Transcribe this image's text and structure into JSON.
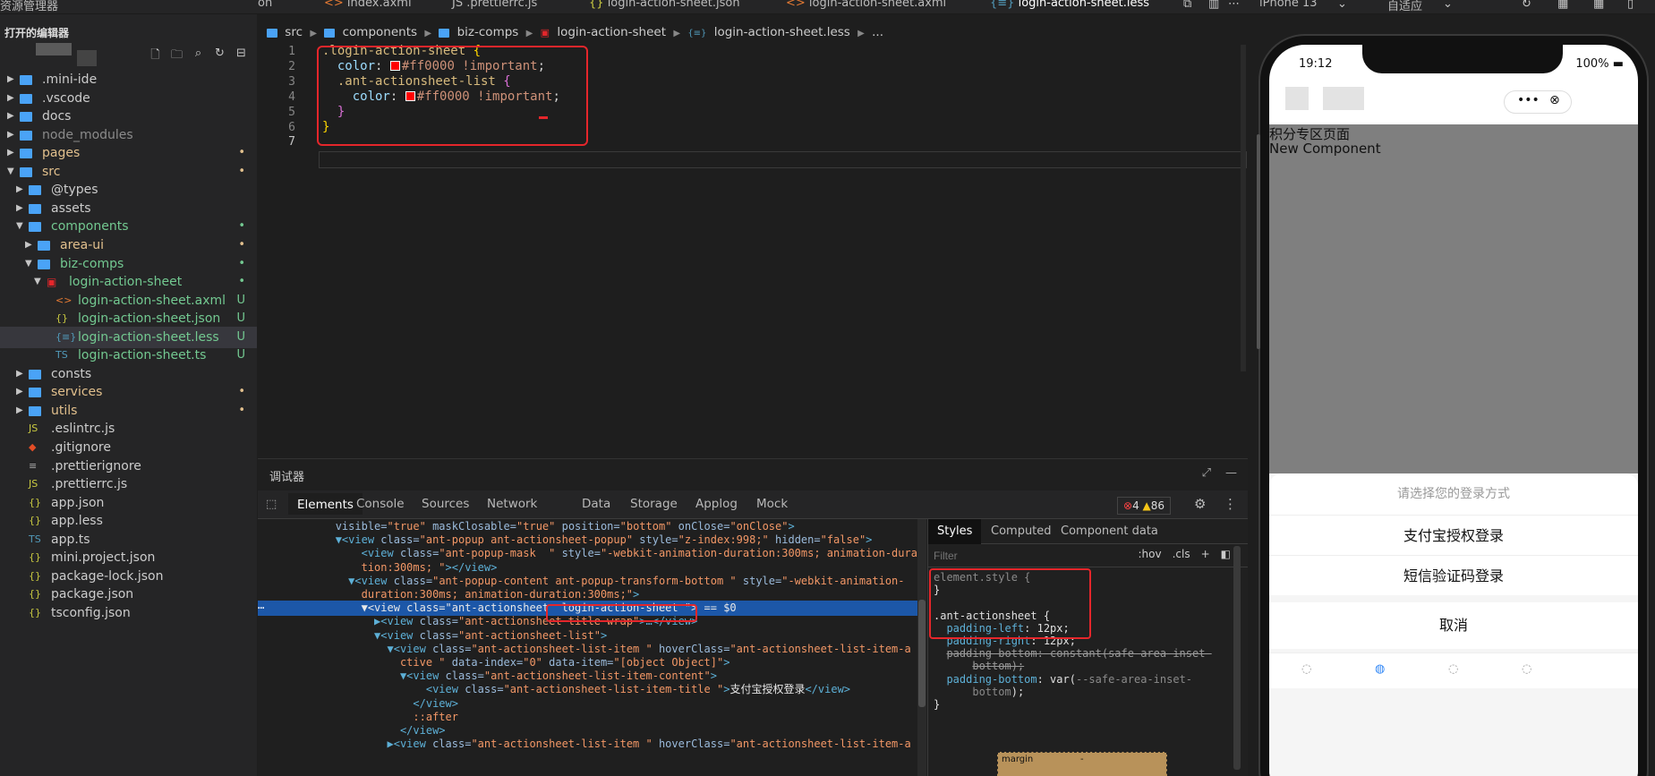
{
  "topbar": {
    "explorer_title": "资源管理器",
    "tabs": [
      {
        "icon": "json-file-icon",
        "label": "on"
      },
      {
        "icon": "axml-file-icon",
        "label": "index.axml"
      },
      {
        "icon": "js-file-icon",
        "label": "JS .prettierrc.js"
      },
      {
        "icon": "json-file-icon",
        "label": "login-action-sheet.json"
      },
      {
        "icon": "axml-file-icon",
        "label": "login-action-sheet.axml"
      },
      {
        "icon": "less-file-icon",
        "label": "login-action-sheet.less",
        "active": true
      }
    ],
    "device": "iPhone 13",
    "zoom": "自适应"
  },
  "sidebar": {
    "open_editors": "打开的编辑器",
    "tree": [
      {
        "name": ".mini-ide",
        "type": "folder",
        "depth": 0,
        "open": false,
        "status": ""
      },
      {
        "name": ".vscode",
        "type": "folder",
        "depth": 0,
        "open": false,
        "status": ""
      },
      {
        "name": "docs",
        "type": "folder",
        "depth": 0,
        "open": false,
        "status": ""
      },
      {
        "name": "node_modules",
        "type": "folder",
        "depth": 0,
        "open": false,
        "status": "",
        "dim": true
      },
      {
        "name": "pages",
        "type": "folder",
        "depth": 0,
        "open": false,
        "status": "•",
        "color": "#e2c08d"
      },
      {
        "name": "src",
        "type": "folder",
        "depth": 0,
        "open": true,
        "status": "•",
        "color": "#e2c08d"
      },
      {
        "name": "@types",
        "type": "folder",
        "depth": 1,
        "open": false,
        "status": ""
      },
      {
        "name": "assets",
        "type": "folder",
        "depth": 1,
        "open": false,
        "status": ""
      },
      {
        "name": "components",
        "type": "folder",
        "depth": 1,
        "open": true,
        "status": "•",
        "color": "#73c991"
      },
      {
        "name": "area-ui",
        "type": "folder",
        "depth": 2,
        "open": false,
        "status": "•",
        "color": "#e2c08d"
      },
      {
        "name": "biz-comps",
        "type": "folder",
        "depth": 2,
        "open": true,
        "status": "•",
        "color": "#73c991"
      },
      {
        "name": "login-action-sheet",
        "type": "folder-special",
        "depth": 3,
        "open": true,
        "status": "•",
        "color": "#73c991"
      },
      {
        "name": "login-action-sheet.axml",
        "type": "file",
        "icon": "<>",
        "iconColor": "#e37933",
        "depth": 4,
        "status": "U",
        "color": "#73c991"
      },
      {
        "name": "login-action-sheet.json",
        "type": "file",
        "icon": "{}",
        "iconColor": "#cbcb41",
        "depth": 4,
        "status": "U",
        "color": "#73c991"
      },
      {
        "name": "login-action-sheet.less",
        "type": "file",
        "icon": "{≡}",
        "iconColor": "#519aba",
        "depth": 4,
        "status": "U",
        "color": "#73c991",
        "selected": true
      },
      {
        "name": "login-action-sheet.ts",
        "type": "file",
        "icon": "TS",
        "iconColor": "#519aba",
        "depth": 4,
        "status": "U",
        "color": "#73c991"
      },
      {
        "name": "consts",
        "type": "folder",
        "depth": 1,
        "open": false,
        "status": ""
      },
      {
        "name": "services",
        "type": "folder",
        "depth": 1,
        "open": false,
        "status": "•",
        "color": "#e2c08d"
      },
      {
        "name": "utils",
        "type": "folder",
        "depth": 1,
        "open": false,
        "status": "•",
        "color": "#e2c08d"
      },
      {
        "name": ".eslintrc.js",
        "type": "file",
        "icon": "JS",
        "iconColor": "#cbcb41",
        "depth": 1,
        "status": ""
      },
      {
        "name": ".gitignore",
        "type": "file",
        "icon": "◆",
        "iconColor": "#e44d26",
        "depth": 1,
        "status": ""
      },
      {
        "name": ".prettierignore",
        "type": "file",
        "icon": "≡",
        "iconColor": "#aaaaaa",
        "depth": 1,
        "status": ""
      },
      {
        "name": ".prettierrc.js",
        "type": "file",
        "icon": "JS",
        "iconColor": "#cbcb41",
        "depth": 1,
        "status": ""
      },
      {
        "name": "app.json",
        "type": "file",
        "icon": "{}",
        "iconColor": "#cbcb41",
        "depth": 1,
        "status": ""
      },
      {
        "name": "app.less",
        "type": "file",
        "icon": "{}",
        "iconColor": "#cbcb41",
        "depth": 1,
        "status": ""
      },
      {
        "name": "app.ts",
        "type": "file",
        "icon": "TS",
        "iconColor": "#519aba",
        "depth": 1,
        "status": ""
      },
      {
        "name": "mini.project.json",
        "type": "file",
        "icon": "{}",
        "iconColor": "#cbcb41",
        "depth": 1,
        "status": ""
      },
      {
        "name": "package-lock.json",
        "type": "file",
        "icon": "{}",
        "iconColor": "#cbcb41",
        "depth": 1,
        "status": ""
      },
      {
        "name": "package.json",
        "type": "file",
        "icon": "{}",
        "iconColor": "#cbcb41",
        "depth": 1,
        "status": ""
      },
      {
        "name": "tsconfig.json",
        "type": "file",
        "icon": "{}",
        "iconColor": "#cbcb41",
        "depth": 1,
        "status": ""
      }
    ]
  },
  "editor": {
    "breadcrumb": [
      "src",
      "components",
      "biz-comps",
      "login-action-sheet",
      "login-action-sheet.less",
      "..."
    ],
    "line_numbers": [
      "1",
      "2",
      "3",
      "4",
      "5",
      "6",
      "7"
    ],
    "lines": [
      [
        {
          "c": "c-sel",
          "t": ".login-action-sheet "
        },
        {
          "c": "c-brace",
          "t": "{"
        }
      ],
      [
        {
          "c": "c-p",
          "t": "  "
        },
        {
          "c": "c-prop",
          "t": "color"
        },
        {
          "c": "c-p",
          "t": ": "
        },
        {
          "c": "sw",
          "t": ""
        },
        {
          "c": "c-val",
          "t": "#ff0000 !important"
        },
        {
          "c": "c-p",
          "t": ";"
        }
      ],
      [
        {
          "c": "c-p",
          "t": "  "
        },
        {
          "c": "c-sel",
          "t": ".ant-actionsheet-list "
        },
        {
          "c": "c-brace2",
          "t": "{"
        }
      ],
      [
        {
          "c": "c-p",
          "t": "    "
        },
        {
          "c": "c-prop",
          "t": "color"
        },
        {
          "c": "c-p",
          "t": ": "
        },
        {
          "c": "sw",
          "t": ""
        },
        {
          "c": "c-val",
          "t": "#ff0000 !important"
        },
        {
          "c": "c-p",
          "t": ";"
        }
      ],
      [
        {
          "c": "c-p",
          "t": "  "
        },
        {
          "c": "c-brace2",
          "t": "}"
        }
      ],
      [
        {
          "c": "c-brace",
          "t": "}"
        }
      ],
      [
        {
          "c": "c-p",
          "t": ""
        }
      ]
    ]
  },
  "debugger": {
    "title": "调试器",
    "tabs": [
      "Elements",
      "Console",
      "Sources",
      "Network",
      "Data",
      "Storage",
      "Applog",
      "Mock"
    ],
    "errors": "4",
    "warnings": "86",
    "elements": [
      {
        "indent": 6,
        "html": [
          {
            "c": "t-attr",
            "t": "visible="
          },
          {
            "c": "t-val",
            "t": "\"true\""
          },
          {
            "c": "t-attr",
            "t": " maskClosable="
          },
          {
            "c": "t-val",
            "t": "\"true\""
          },
          {
            "c": "t-attr",
            "t": " position="
          },
          {
            "c": "t-val",
            "t": "\"bottom\""
          },
          {
            "c": "t-attr",
            "t": " onClose="
          },
          {
            "c": "t-val",
            "t": "\"onClose\""
          },
          {
            "c": "t-tag",
            "t": ">"
          }
        ]
      },
      {
        "indent": 6,
        "html": [
          {
            "c": "t-tag",
            "t": "▼<view "
          },
          {
            "c": "t-attr",
            "t": "class="
          },
          {
            "c": "t-val",
            "t": "\"ant-popup ant-actionsheet-popup\""
          },
          {
            "c": "t-attr",
            "t": " style="
          },
          {
            "c": "t-val",
            "t": "\"z-index:998;\""
          },
          {
            "c": "t-attr",
            "t": " hidden="
          },
          {
            "c": "t-val",
            "t": "\"false\""
          },
          {
            "c": "t-tag",
            "t": ">"
          }
        ]
      },
      {
        "indent": 8,
        "html": [
          {
            "c": "t-tag",
            "t": "<view "
          },
          {
            "c": "t-attr",
            "t": "class="
          },
          {
            "c": "t-val",
            "t": "\"ant-popup-mask  \""
          },
          {
            "c": "t-attr",
            "t": " style="
          },
          {
            "c": "t-val",
            "t": "\"-webkit-animation-duration:300ms; animation-dura"
          }
        ]
      },
      {
        "indent": 8,
        "html": [
          {
            "c": "t-val",
            "t": "tion:300ms; \""
          },
          {
            "c": "t-tag",
            "t": "></view>"
          }
        ]
      },
      {
        "indent": 7,
        "html": [
          {
            "c": "t-tag",
            "t": "▼<view "
          },
          {
            "c": "t-attr",
            "t": "class="
          },
          {
            "c": "t-val",
            "t": "\"ant-popup-content ant-popup-transform-bottom \""
          },
          {
            "c": "t-attr",
            "t": " style="
          },
          {
            "c": "t-val",
            "t": "\"-webkit-animation-"
          }
        ]
      },
      {
        "indent": 8,
        "html": [
          {
            "c": "t-val",
            "t": "duration:300ms; animation-duration:300ms;\""
          },
          {
            "c": "t-tag",
            "t": ">"
          }
        ]
      },
      {
        "indent": 8,
        "hl": true,
        "html": [
          {
            "c": "t-text",
            "t": "▼<view class=\"ant-actionsheet  login-action-sheet \"> == $0"
          }
        ]
      },
      {
        "indent": 9,
        "html": [
          {
            "c": "t-tag",
            "t": "▶<view "
          },
          {
            "c": "t-attr",
            "t": "class="
          },
          {
            "c": "t-val",
            "t": "\"ant-actionsheet-title-wrap\""
          },
          {
            "c": "t-tag",
            "t": ">…</view>"
          }
        ]
      },
      {
        "indent": 9,
        "html": [
          {
            "c": "t-tag",
            "t": "▼<view "
          },
          {
            "c": "t-attr",
            "t": "class="
          },
          {
            "c": "t-val",
            "t": "\"ant-actionsheet-list\""
          },
          {
            "c": "t-tag",
            "t": ">"
          }
        ]
      },
      {
        "indent": 10,
        "html": [
          {
            "c": "t-tag",
            "t": "▼<view "
          },
          {
            "c": "t-attr",
            "t": "class="
          },
          {
            "c": "t-val",
            "t": "\"ant-actionsheet-list-item \""
          },
          {
            "c": "t-attr",
            "t": " hoverClass="
          },
          {
            "c": "t-val",
            "t": "\"ant-actionsheet-list-item-a"
          }
        ]
      },
      {
        "indent": 11,
        "html": [
          {
            "c": "t-val",
            "t": "ctive \""
          },
          {
            "c": "t-attr",
            "t": " data-index="
          },
          {
            "c": "t-val",
            "t": "\"0\""
          },
          {
            "c": "t-attr",
            "t": " data-item="
          },
          {
            "c": "t-val",
            "t": "\"[object Object]\""
          },
          {
            "c": "t-tag",
            "t": ">"
          }
        ]
      },
      {
        "indent": 11,
        "html": [
          {
            "c": "t-tag",
            "t": "▼<view "
          },
          {
            "c": "t-attr",
            "t": "class="
          },
          {
            "c": "t-val",
            "t": "\"ant-actionsheet-list-item-content\""
          },
          {
            "c": "t-tag",
            "t": ">"
          }
        ]
      },
      {
        "indent": 13,
        "html": [
          {
            "c": "t-tag",
            "t": "<view "
          },
          {
            "c": "t-attr",
            "t": "class="
          },
          {
            "c": "t-val",
            "t": "\"ant-actionsheet-list-item-title \""
          },
          {
            "c": "t-tag",
            "t": ">"
          },
          {
            "c": "t-text",
            "t": "支付宝授权登录"
          },
          {
            "c": "t-tag",
            "t": "</view>"
          }
        ]
      },
      {
        "indent": 12,
        "html": [
          {
            "c": "t-tag",
            "t": "</view>"
          }
        ]
      },
      {
        "indent": 12,
        "html": [
          {
            "c": "t-val",
            "t": "::after"
          }
        ]
      },
      {
        "indent": 11,
        "html": [
          {
            "c": "t-tag",
            "t": "</view>"
          }
        ]
      },
      {
        "indent": 10,
        "html": [
          {
            "c": "t-tag",
            "t": "▶<view "
          },
          {
            "c": "t-attr",
            "t": "class="
          },
          {
            "c": "t-val",
            "t": "\"ant-actionsheet-list-item \""
          },
          {
            "c": "t-attr",
            "t": " hoverClass="
          },
          {
            "c": "t-val",
            "t": "\"ant-actionsheet-list-item-a"
          }
        ]
      }
    ],
    "styles_tabs": [
      "Styles",
      "Computed",
      "Component data"
    ],
    "filter_placeholder": "Filter",
    "filter_actions": [
      ":hov",
      ".cls",
      "+"
    ],
    "styles": [
      {
        "html": [
          {
            "c": "s-dim",
            "t": "element.style {"
          }
        ]
      },
      {
        "html": [
          {
            "c": "",
            "t": "}"
          }
        ]
      },
      {
        "html": [
          {
            "c": "",
            "t": ""
          }
        ]
      },
      {
        "html": [
          {
            "c": "",
            "t": ".ant-actionsheet {"
          }
        ]
      },
      {
        "html": [
          {
            "c": "",
            "t": "  "
          },
          {
            "c": "s-prop",
            "t": "padding-left"
          },
          {
            "c": "",
            "t": ": 12px;"
          }
        ]
      },
      {
        "html": [
          {
            "c": "",
            "t": "  "
          },
          {
            "c": "s-prop",
            "t": "padding-right"
          },
          {
            "c": "",
            "t": ": 12px;"
          }
        ]
      },
      {
        "html": [
          {
            "c": "",
            "t": "  "
          },
          {
            "c": "s-strike",
            "t": "padding-bottom: constant(safe-area-inset-"
          }
        ]
      },
      {
        "html": [
          {
            "c": "",
            "t": "      "
          },
          {
            "c": "s-strike",
            "t": "bottom);"
          }
        ]
      },
      {
        "html": [
          {
            "c": "",
            "t": "  "
          },
          {
            "c": "s-prop",
            "t": "padding-bottom"
          },
          {
            "c": "",
            "t": ": var("
          },
          {
            "c": "s-dim",
            "t": "--safe-area-inset-"
          }
        ]
      },
      {
        "html": [
          {
            "c": "",
            "t": "      "
          },
          {
            "c": "s-dim",
            "t": "bottom"
          },
          {
            "c": "",
            "t": ");"
          }
        ]
      },
      {
        "html": [
          {
            "c": "",
            "t": "}"
          }
        ]
      }
    ],
    "boxmodel_label": "margin",
    "boxmodel_value": "-"
  },
  "simulator": {
    "time": "19:12",
    "battery": "100%",
    "page_title": "积分专区页面",
    "page_sub": "New Component",
    "sheet_title": "请选择您的登录方式",
    "item1": "支付宝授权登录",
    "item2": "短信验证码登录",
    "cancel": "取消"
  },
  "colors": {
    "accent_red": "#e5262b",
    "selection_blue": "#1c57a8",
    "git_untracked": "#73c991",
    "git_modified": "#e2c08d"
  }
}
